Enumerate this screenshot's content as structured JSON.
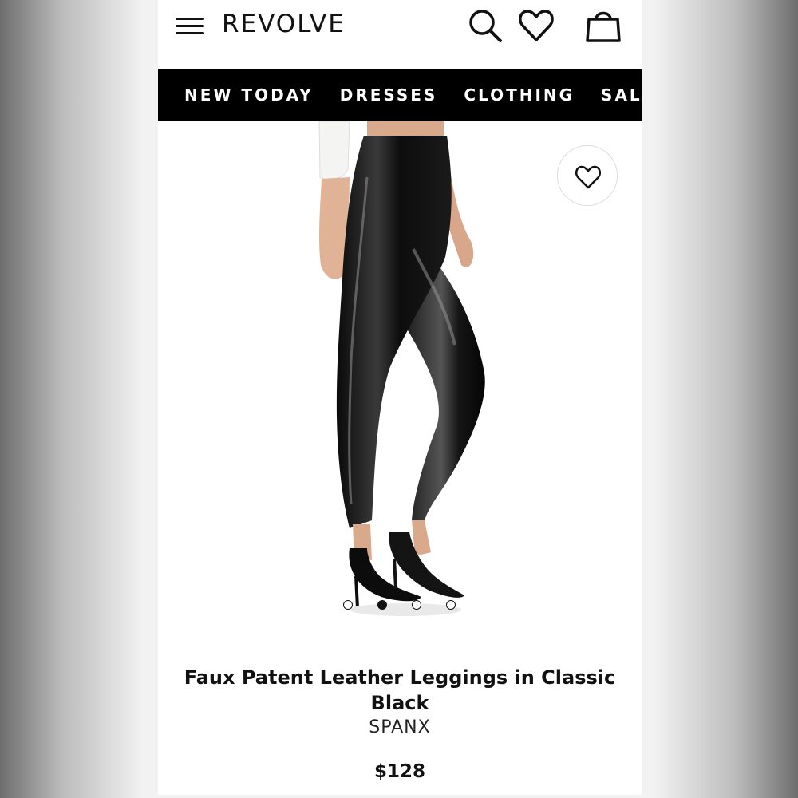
{
  "header": {
    "logo": "REVOLVE",
    "icons": [
      "menu-icon",
      "search-icon",
      "heart-icon",
      "shopping-bag-icon"
    ]
  },
  "nav": {
    "items": [
      {
        "label": "NEW TODAY"
      },
      {
        "label": "DRESSES"
      },
      {
        "label": "CLOTHING"
      },
      {
        "label": "SALE"
      }
    ]
  },
  "product": {
    "title": "Faux Patent Leather Leggings in Classic Black",
    "brand": "SPANX",
    "price": "$128",
    "image_count": 4,
    "active_image": 2
  },
  "colors": {
    "accent": "#000000",
    "background": "#ffffff"
  }
}
